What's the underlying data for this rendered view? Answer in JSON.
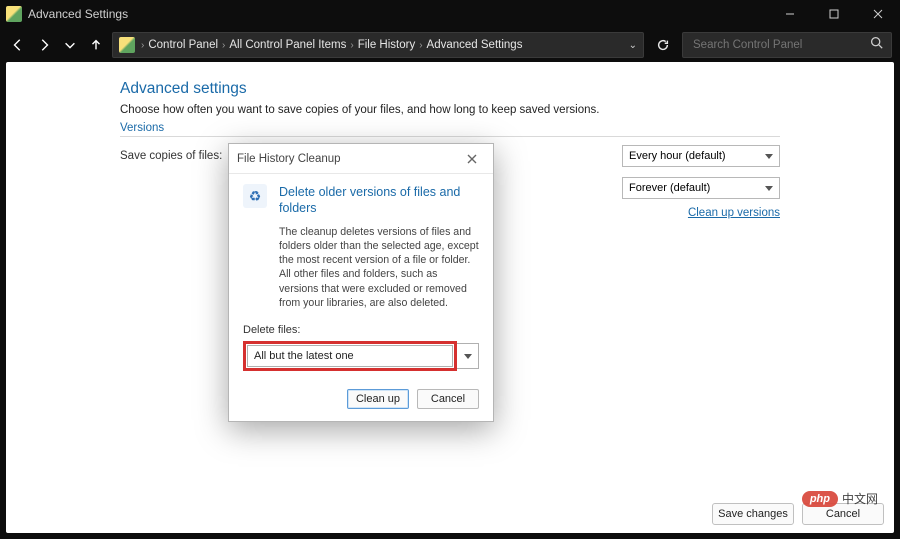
{
  "titlebar": {
    "title": "Advanced Settings"
  },
  "breadcrumb": {
    "items": [
      "Control Panel",
      "All Control Panel Items",
      "File History",
      "Advanced Settings"
    ]
  },
  "search": {
    "placeholder": "Search Control Panel"
  },
  "page": {
    "heading": "Advanced settings",
    "subtitle": "Choose how often you want to save copies of your files, and how long to keep saved versions.",
    "section_label": "Versions",
    "row1_label": "Save copies of files:",
    "row1_value": "Every hour (default)",
    "row2_label": "",
    "row2_value": "Forever (default)",
    "cleanup_link": "Clean up versions"
  },
  "dialog": {
    "title": "File History Cleanup",
    "heading": "Delete older versions of files and folders",
    "desc": "The cleanup deletes versions of files and folders older than the selected age, except the most recent version of a file or folder. All other files and folders, such as versions that were excluded or removed from your libraries, are also deleted.",
    "delete_label": "Delete files:",
    "delete_value": "All but the latest one",
    "cleanup_btn": "Clean up",
    "cancel_btn": "Cancel"
  },
  "footer": {
    "save": "Save changes",
    "cancel": "Cancel"
  },
  "watermark": {
    "badge": "php",
    "text": "中文网"
  }
}
